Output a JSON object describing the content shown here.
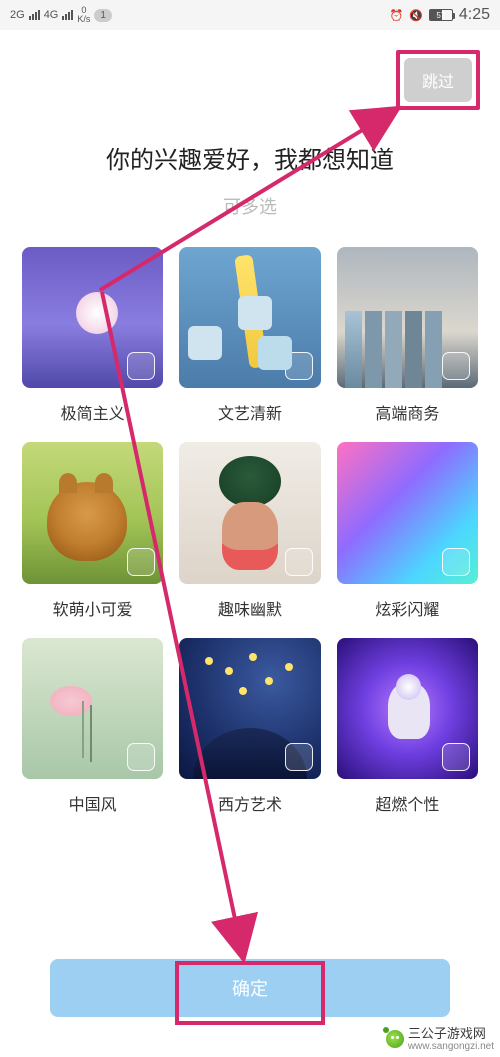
{
  "status": {
    "net1": "2G",
    "net2": "4G",
    "speed_top": "0",
    "speed_unit": "K/s",
    "sim": "1",
    "battery_pct": "57",
    "time": "4:25"
  },
  "skip_label": "跳过",
  "title": "你的兴趣爱好，我都想知道",
  "subtitle": "可多选",
  "cards": [
    {
      "label": "极简主义"
    },
    {
      "label": "文艺清新"
    },
    {
      "label": "高端商务"
    },
    {
      "label": "软萌小可爱"
    },
    {
      "label": "趣味幽默"
    },
    {
      "label": "炫彩闪耀"
    },
    {
      "label": "中国风"
    },
    {
      "label": "西方艺术"
    },
    {
      "label": "超燃个性"
    }
  ],
  "confirm_label": "确定",
  "watermark": {
    "brand": "三公子游戏网",
    "url": "www.sangongzi.net"
  }
}
